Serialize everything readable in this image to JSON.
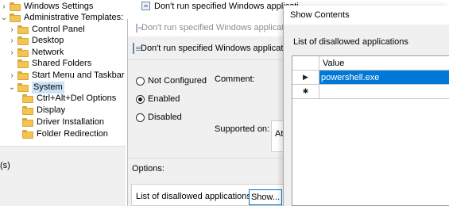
{
  "tree": {
    "items": [
      {
        "label": "Windows Settings",
        "expanded": false,
        "selected": false
      },
      {
        "label": "Administrative Templates: Pol",
        "expanded": true,
        "selected": false
      },
      {
        "label": "Control Panel",
        "expanded": false,
        "selected": false
      },
      {
        "label": "Desktop",
        "expanded": false,
        "selected": false
      },
      {
        "label": "Network",
        "expanded": false,
        "selected": false
      },
      {
        "label": "Shared Folders",
        "expanded": false,
        "selected": false
      },
      {
        "label": "Start Menu and Taskbar",
        "expanded": false,
        "selected": false
      },
      {
        "label": "System",
        "expanded": true,
        "selected": true
      },
      {
        "label": "Ctrl+Alt+Del Options",
        "expanded": false,
        "selected": false
      },
      {
        "label": "Display",
        "expanded": false,
        "selected": false
      },
      {
        "label": "Driver Installation",
        "expanded": false,
        "selected": false
      },
      {
        "label": "Folder Redirection",
        "expanded": false,
        "selected": false
      }
    ],
    "status_text": "(s)"
  },
  "background_list": {
    "row1": "Don't run specified Windows applicati"
  },
  "policy_window": {
    "title": "Don't run specified Windows applicatio",
    "headline": "Don't run specified Windows applicatio",
    "radios": [
      {
        "label": "Not Configured",
        "checked": false
      },
      {
        "label": "Enabled",
        "checked": true
      },
      {
        "label": "Disabled",
        "checked": false
      }
    ],
    "comment_label": "Comment:",
    "supported_label": "Supported on:",
    "supported_value": "At",
    "options_label": "Options:",
    "list_label": "List of disallowed applications",
    "show_button": "Show..."
  },
  "show_contents": {
    "title": "Show Contents",
    "list_label": "List of disallowed applications",
    "column_header": "Value",
    "rows": [
      {
        "marker": "▶",
        "value": "powershell.exe",
        "selected": true
      },
      {
        "marker": "✱",
        "value": "",
        "selected": false
      }
    ]
  }
}
